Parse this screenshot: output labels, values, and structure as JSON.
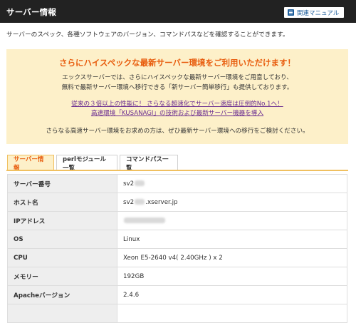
{
  "header": {
    "title": "サーバー情報",
    "manual_button": "関連マニュアル"
  },
  "description": "サーバーのスペック、各種ソフトウェアのバージョン、コマンドパスなどを確認することができます。",
  "promo": {
    "title": "さらにハイスペックな最新サーバー環境をご利用いただけます！",
    "line1": "エックスサーバーでは、さらにハイスペックな最新サーバー環境をご用意しており、",
    "line2": "無料で最新サーバー環境へ移行できる「新サーバー簡単移行」も提供しております。",
    "link1": "従来の３倍以上の性能に！ さらなる超速化でサーバー速度は圧倒的No.1へ！",
    "link2": "高速環境「KUSANAGI」の技術および最新サーバー機器を導入",
    "footer": "さらなる高速サーバー環境をお求めの方は、ぜひ最新サーバー環境への移行をご検討ください。"
  },
  "tabs": [
    {
      "label": "サーバー情報",
      "active": true
    },
    {
      "label": "perlモジュール一覧",
      "active": false
    },
    {
      "label": "コマンドパス一覧",
      "active": false
    }
  ],
  "spec_rows": [
    {
      "key": "サーバー番号",
      "value": "sv2",
      "masked": "number"
    },
    {
      "key": "ホスト名",
      "value_prefix": "sv2",
      "value_suffix": ".xserver.jp",
      "masked": "host"
    },
    {
      "key": "IPアドレス",
      "value": "",
      "masked": "ip"
    },
    {
      "key": "OS",
      "value": "Linux"
    },
    {
      "key": "CPU",
      "value": "Xeon E5-2640 v4( 2.40GHz ) x 2"
    },
    {
      "key": "メモリー",
      "value": "192GB"
    },
    {
      "key": "Apacheバージョン",
      "value": "2.4.6"
    },
    {
      "key": "",
      "value": ""
    }
  ],
  "colors": {
    "header_bg": "#222222",
    "accent_orange": "#e85c0d",
    "promo_bg": "#fdf0c9",
    "link_purple": "#6a2c91",
    "manual_blue": "#1f5f9c"
  }
}
